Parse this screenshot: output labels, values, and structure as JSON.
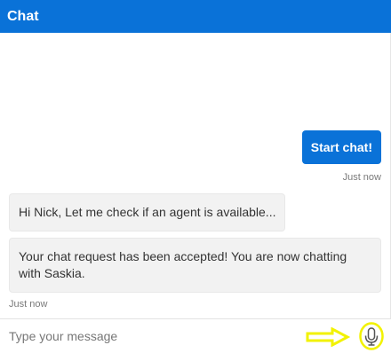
{
  "header": {
    "title": "Chat"
  },
  "messages": {
    "outgoing": {
      "text": "Start chat!",
      "timestamp": "Just now"
    },
    "incoming": [
      {
        "text": "Hi Nick, Let me check if an agent is available..."
      },
      {
        "text": "Your chat request has been accepted! You are now chatting with Saskia."
      }
    ],
    "incoming_timestamp": "Just now"
  },
  "composer": {
    "placeholder": "Type your message",
    "mic_icon": "microphone-icon",
    "highlight_color": "#f2f200"
  },
  "colors": {
    "header": "#0a72d8",
    "outgoing_bubble": "#0a72d8",
    "incoming_bubble": "#f2f2f2",
    "annotation": "#f2f200"
  }
}
